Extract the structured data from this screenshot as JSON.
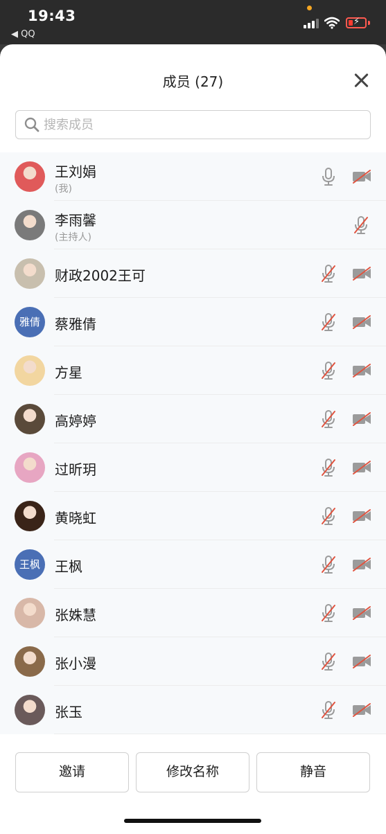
{
  "status_bar": {
    "time": "19:43",
    "back_app": "◀ QQ"
  },
  "sheet": {
    "title": "成员 (27)",
    "close_icon": "close-icon"
  },
  "search": {
    "placeholder": "搜索成员",
    "value": ""
  },
  "members": [
    {
      "name": "王刘娟",
      "subtitle": "(我)",
      "avatar": "photo",
      "mic_muted": false,
      "camera_off": true,
      "avatar_color": "#e05a5a"
    },
    {
      "name": "李雨馨",
      "subtitle": "(主持人)",
      "avatar": "photo",
      "mic_muted": true,
      "camera_off": null,
      "avatar_color": "#7a7a7a"
    },
    {
      "name": "财政2002王可",
      "subtitle": "",
      "avatar": "photo",
      "mic_muted": true,
      "camera_off": true,
      "avatar_color": "#c8bfae"
    },
    {
      "name": "蔡雅倩",
      "subtitle": "",
      "avatar": "text",
      "avatar_text": "雅倩",
      "mic_muted": true,
      "camera_off": true,
      "avatar_color": "#4a6fb5"
    },
    {
      "name": "方星",
      "subtitle": "",
      "avatar": "photo",
      "mic_muted": true,
      "camera_off": true,
      "avatar_color": "#f2d6a0"
    },
    {
      "name": "高婷婷",
      "subtitle": "",
      "avatar": "photo",
      "mic_muted": true,
      "camera_off": true,
      "avatar_color": "#5a4a3a"
    },
    {
      "name": "过昕玥",
      "subtitle": "",
      "avatar": "photo",
      "mic_muted": true,
      "camera_off": true,
      "avatar_color": "#e7a6c2"
    },
    {
      "name": "黄晓虹",
      "subtitle": "",
      "avatar": "photo",
      "mic_muted": true,
      "camera_off": true,
      "avatar_color": "#3a2418"
    },
    {
      "name": "王枫",
      "subtitle": "",
      "avatar": "text",
      "avatar_text": "王枫",
      "mic_muted": true,
      "camera_off": true,
      "avatar_color": "#4a6fb5"
    },
    {
      "name": "张姝慧",
      "subtitle": "",
      "avatar": "photo",
      "mic_muted": true,
      "camera_off": true,
      "avatar_color": "#d8b8a8"
    },
    {
      "name": "张小漫",
      "subtitle": "",
      "avatar": "photo",
      "mic_muted": true,
      "camera_off": true,
      "avatar_color": "#8a6a4a"
    },
    {
      "name": "张玉",
      "subtitle": "",
      "avatar": "photo",
      "mic_muted": true,
      "camera_off": true,
      "avatar_color": "#6a5a5a"
    }
  ],
  "buttons": {
    "invite": "邀请",
    "rename": "修改名称",
    "mute": "静音"
  },
  "colors": {
    "muted_slash": "#e0533f",
    "icon_gray": "#9b9b9b",
    "text_avatar": "#4a6fb5"
  }
}
